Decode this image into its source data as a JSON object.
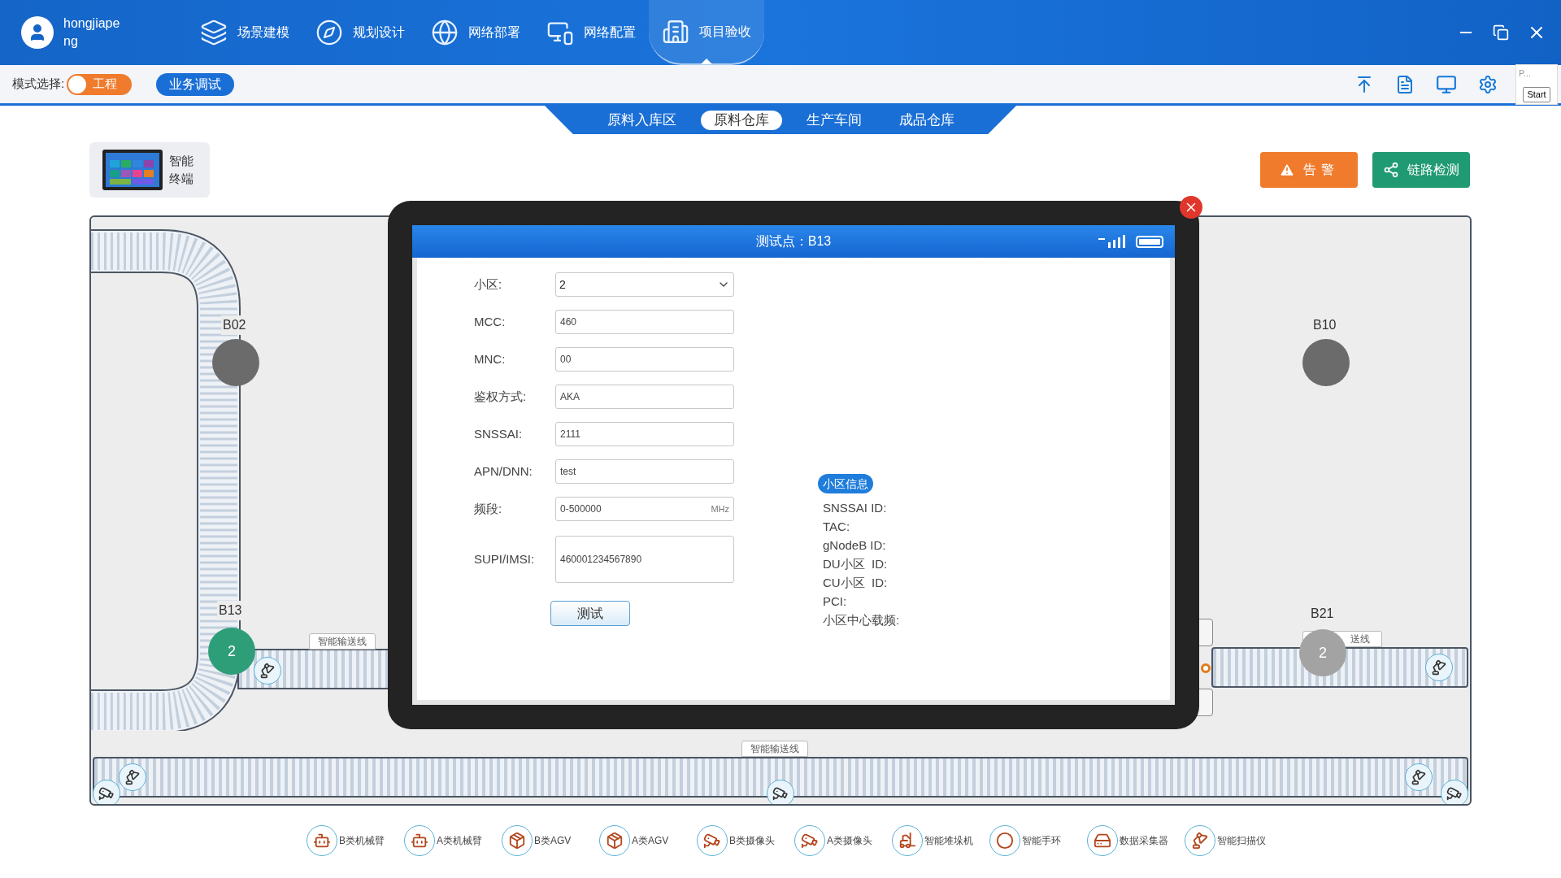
{
  "user": {
    "name": "hongjiapeng"
  },
  "nav": [
    {
      "kind": "layers",
      "label": "场景建模",
      "selected": false
    },
    {
      "kind": "compass",
      "label": "规划设计",
      "selected": false
    },
    {
      "kind": "globe",
      "label": "网络部署",
      "selected": false
    },
    {
      "kind": "code",
      "label": "网络配置",
      "selected": false
    },
    {
      "kind": "building",
      "label": "项目验收",
      "selected": true
    }
  ],
  "toolbar": {
    "mode_label": "模式选择:",
    "mode_toggle": {
      "label": "工程",
      "on": true
    },
    "debug_button": "业务调试",
    "mini_panel": {
      "title": "P...",
      "button": "Start"
    }
  },
  "zone_tabs": [
    {
      "label": "原料入库区",
      "selected": false
    },
    {
      "label": "原料仓库",
      "selected": true
    },
    {
      "label": "生产车间",
      "selected": false
    },
    {
      "label": "成品仓库",
      "selected": false
    }
  ],
  "terminal": {
    "label": "智能终端"
  },
  "actions": [
    {
      "kind": "alarm",
      "label": "告警"
    },
    {
      "kind": "link",
      "label": "链路检测"
    }
  ],
  "canvas": {
    "nodes": [
      {
        "label": "B02",
        "color": "#6b6b6b"
      },
      {
        "label": "B10",
        "color": "#6b6b6b"
      },
      {
        "label": "B13",
        "color": "#2e9e78",
        "count": "2"
      },
      {
        "label": "B21",
        "color": "#a3a3a3",
        "count": "2"
      }
    ],
    "conveyor_labels": [
      "智能输送线",
      "智能输送线",
      "送线"
    ]
  },
  "dialog": {
    "title": "测试点：B13",
    "fields": [
      {
        "kind": "select",
        "label": "小区:",
        "value": "2"
      },
      {
        "kind": "input",
        "label": "MCC:",
        "value": "460"
      },
      {
        "kind": "input",
        "label": "MNC:",
        "value": "00"
      },
      {
        "kind": "input",
        "label": "鉴权方式:",
        "value": "AKA"
      },
      {
        "kind": "input",
        "label": "SNSSAI:",
        "value": "2111"
      },
      {
        "kind": "input",
        "label": "APN/DNN:",
        "value": "test"
      },
      {
        "kind": "input",
        "label": "频段:",
        "value": "0-500000",
        "unit": "MHz"
      },
      {
        "kind": "textarea",
        "label": "SUPI/IMSI:",
        "value": "460001234567890"
      }
    ],
    "test_button": "测试",
    "info": {
      "title": "小区信息",
      "lines": [
        "SNSSAI ID:",
        "TAC:",
        "gNodeB ID:",
        "DU小区  ID:",
        "CU小区  ID:",
        "PCI:",
        "小区中心载频:"
      ]
    }
  },
  "legend": [
    {
      "kind": "arm",
      "label": "B类机械臂"
    },
    {
      "kind": "arm",
      "label": "A类机械臂"
    },
    {
      "kind": "agv",
      "label": "B类AGV"
    },
    {
      "kind": "agv",
      "label": "A类AGV"
    },
    {
      "kind": "camera",
      "label": "B类摄像头"
    },
    {
      "kind": "camera",
      "label": "A类摄像头"
    },
    {
      "kind": "stacker",
      "label": "智能堆垛机"
    },
    {
      "kind": "band",
      "label": "智能手环"
    },
    {
      "kind": "collector",
      "label": "数据采集器"
    },
    {
      "kind": "scanner",
      "label": "智能扫描仪"
    }
  ]
}
